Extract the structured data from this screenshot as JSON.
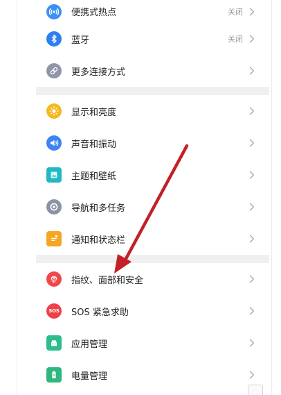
{
  "groups": [
    [
      {
        "label": "便携式热点",
        "value": "关闭",
        "icon": "hotspot-icon",
        "color": "#3d8ff5"
      },
      {
        "label": "蓝牙",
        "value": "关闭",
        "icon": "bluetooth-icon",
        "color": "#2f7ff2"
      },
      {
        "label": "更多连接方式",
        "value": "",
        "icon": "link-icon",
        "color": "#8f96a8"
      }
    ],
    [
      {
        "label": "显示和亮度",
        "value": "",
        "icon": "sun-icon",
        "color": "#f5b81d"
      },
      {
        "label": "声音和振动",
        "value": "",
        "icon": "speaker-icon",
        "color": "#3d83f3"
      },
      {
        "label": "主题和壁纸",
        "value": "",
        "icon": "theme-icon",
        "color": "#1fb8c4"
      },
      {
        "label": "导航和多任务",
        "value": "",
        "icon": "navigation-icon",
        "color": "#8a93a5"
      },
      {
        "label": "通知和状态栏",
        "value": "",
        "icon": "notification-icon",
        "color": "#f5a623"
      }
    ],
    [
      {
        "label": "指纹、面部和安全",
        "value": "",
        "icon": "fingerprint-icon",
        "color": "#f0474a"
      },
      {
        "label": "SOS 紧急求助",
        "value": "",
        "icon": "sos-icon",
        "color": "#ee4046"
      },
      {
        "label": "应用管理",
        "value": "",
        "icon": "android-icon",
        "color": "#2dbd8e"
      },
      {
        "label": "电量管理",
        "value": "",
        "icon": "battery-icon",
        "color": "#2db87e"
      }
    ]
  ],
  "sos_icon_text": "SOS",
  "colors": {
    "arrow": "#c32127",
    "chevron": "#a9a9a9",
    "section_gap": "#f0f0f0"
  }
}
